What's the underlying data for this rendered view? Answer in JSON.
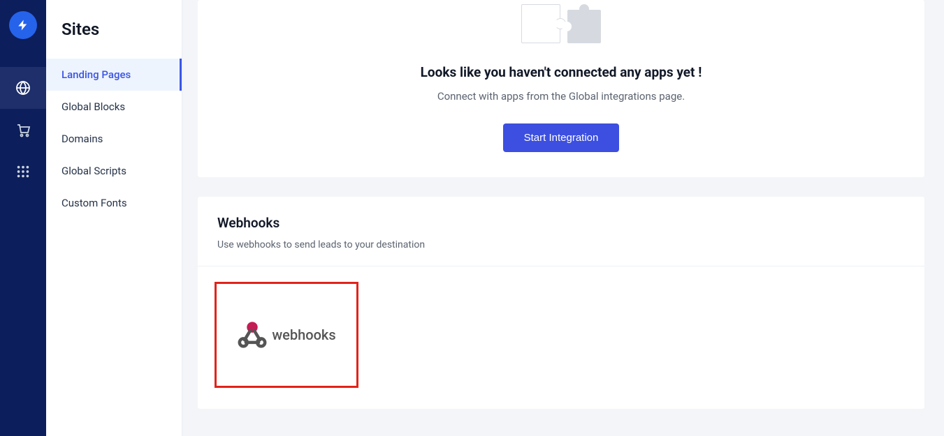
{
  "sidebar": {
    "title": "Sites",
    "items": [
      {
        "label": "Landing Pages",
        "active": true
      },
      {
        "label": "Global Blocks",
        "active": false
      },
      {
        "label": "Domains",
        "active": false
      },
      {
        "label": "Global Scripts",
        "active": false
      },
      {
        "label": "Custom Fonts",
        "active": false
      }
    ]
  },
  "empty_state": {
    "title": "Looks like you haven't connected any apps yet !",
    "subtitle": "Connect with apps from the Global integrations page.",
    "button": "Start Integration"
  },
  "webhooks": {
    "title": "Webhooks",
    "subtitle": "Use webhooks to send leads to your destination",
    "tile_label": "webhooks"
  }
}
